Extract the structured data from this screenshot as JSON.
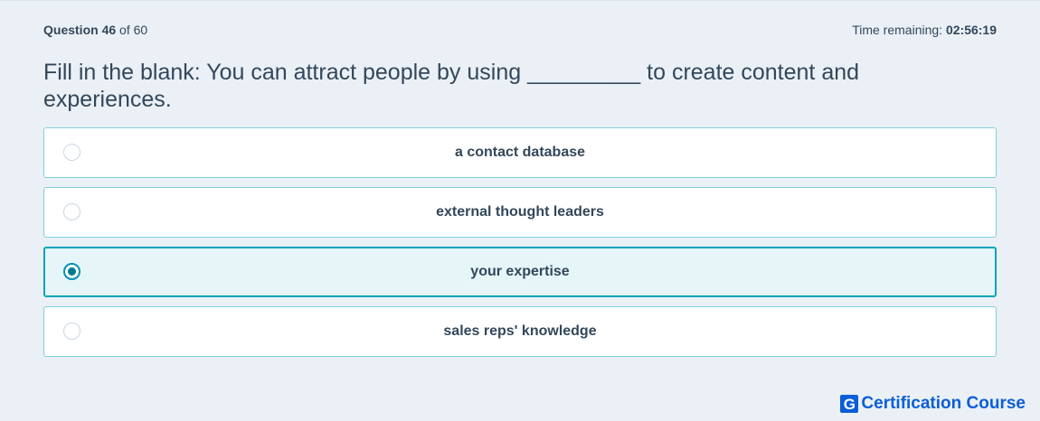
{
  "header": {
    "question_label": "Question",
    "question_number": "46",
    "of_text": "of 60",
    "timer_label": "Time remaining:",
    "timer_value": "02:56:19"
  },
  "question": {
    "text": "Fill in the blank: You can attract people by using _________ to create content and experiences."
  },
  "options": [
    {
      "label": "a contact database",
      "selected": false
    },
    {
      "label": "external thought leaders",
      "selected": false
    },
    {
      "label": "your expertise",
      "selected": true
    },
    {
      "label": "sales reps' knowledge",
      "selected": false
    }
  ],
  "brand": {
    "icon_letter": "G",
    "icon": "brand-logo-icon",
    "text": "Certification Course"
  },
  "colors": {
    "background": "#eaf0f6",
    "option_border": "#7fd1de",
    "selected_bg": "#e5f5f8",
    "selected_border": "#00a4bd",
    "brand": "#0b5ed7"
  }
}
